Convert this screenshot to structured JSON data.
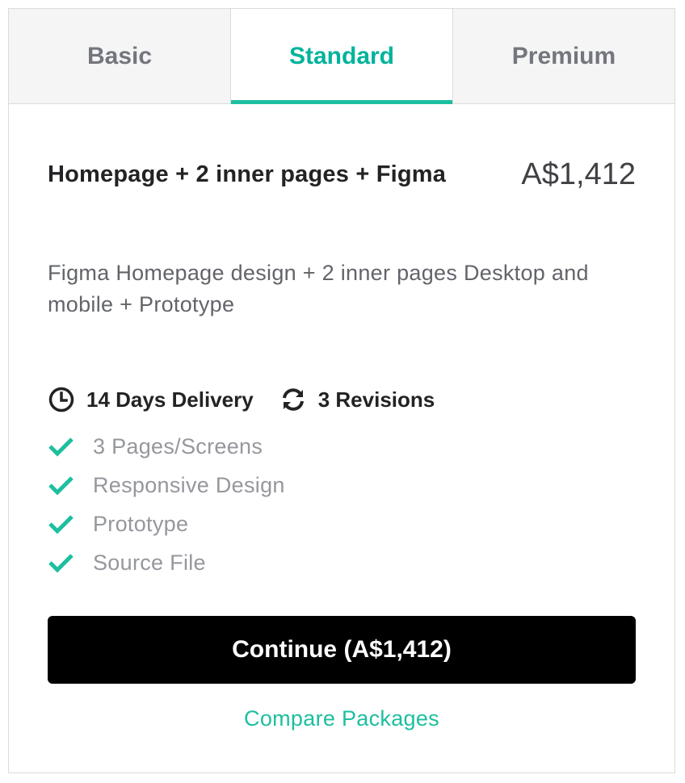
{
  "tabs": [
    {
      "label": "Basic",
      "active": false
    },
    {
      "label": "Standard",
      "active": true
    },
    {
      "label": "Premium",
      "active": false
    }
  ],
  "package": {
    "title": "Homepage + 2 inner pages + Figma",
    "price": "A$1,412",
    "description": "Figma Homepage design + 2 inner pages Desktop and mobile + Prototype",
    "delivery": {
      "icon": "clock-icon",
      "label": "14 Days Delivery"
    },
    "revisions": {
      "icon": "refresh-icon",
      "label": "3 Revisions"
    },
    "features": [
      {
        "label": "3 Pages/Screens",
        "included": true
      },
      {
        "label": "Responsive Design",
        "included": true
      },
      {
        "label": "Prototype",
        "included": true
      },
      {
        "label": "Source File",
        "included": true
      }
    ]
  },
  "actions": {
    "continue_label": "Continue (A$1,412)",
    "compare_label": "Compare Packages"
  },
  "colors": {
    "accent": "#1dbf9f",
    "button_bg": "#000000",
    "tab_inactive_bg": "#f5f5f5"
  }
}
